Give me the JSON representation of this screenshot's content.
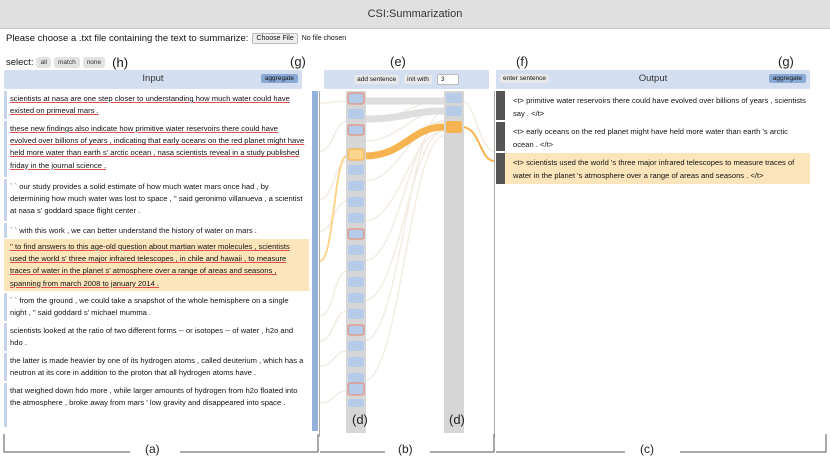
{
  "app": {
    "title": "CSI:Summarization"
  },
  "file": {
    "prompt": "Please choose a .txt file containing the text to summarize:",
    "button": "Choose File",
    "status": "No file chosen"
  },
  "select": {
    "label": "select:",
    "options": [
      "all",
      "match",
      "none"
    ]
  },
  "annotations": {
    "a": "(a)",
    "b": "(b)",
    "c": "(c)",
    "d1": "(d)",
    "d2": "(d)",
    "e": "(e)",
    "f": "(f)",
    "g1": "(g)",
    "g2": "(g)",
    "h": "(h)"
  },
  "input_header": {
    "title": "Input",
    "aggregate": "aggregate"
  },
  "middle_header": {
    "add_sentence": "add sentence",
    "init_with": "init with",
    "init_value": "3"
  },
  "output_header": {
    "enter_sentence": "enter sentence",
    "title": "Output",
    "aggregate": "aggregate"
  },
  "input_sentences": [
    "scientists at nasa are one step closer to understanding how much water could have existed on primeval mars .",
    "these new findings also indicate how primitive water reservoirs there could have evolved over billions of years , indicating that early oceans on the red planet might have held more water than earth s' arctic ocean , nasa scientists reveal in a study published friday in the journal science .",
    "` ` our study provides a solid estimate of how much water mars once had , by determining how much water was lost to space , '' said geronimo villanueva , a scientist at nasa s' goddard space flight center .",
    "` ` with this work , we can better understand the history of water on mars .",
    "'' to find answers to this age-old question about martian water molecules , scientists used the world s' three major infrared telescopes , in chile and hawaii , to measure traces of water in the planet s' atmosphere over a range of areas and seasons , spanning from march 2008 to january 2014 .",
    "` ` from the ground , we could take a snapshot of the whole hemisphere on a single night , '' said goddard s' michael mumma .",
    "scientists looked at the ratio of two different forms -- or isotopes -- of water , h2o and hdo .",
    "the latter is made heavier by one of its hydrogen atoms , called deuterium , which has a neutron at its core in addition to the proton that all hydrogen atoms have .",
    "that weighed down hdo more , while larger amounts of hydrogen from h2o floated into the atmosphere , broke away from mars ' low gravity and disappeared into space ."
  ],
  "output_sentences": [
    "<t> primitive water reservoirs there could have evolved over billions of years , scientists say . </t>",
    "<t> early oceans on the red planet might have held more water than earth 's arctic ocean . </t>",
    "<t> scientists used the world 's three major infrared telescopes to measure traces of water in the planet 's atmosphere over a range of areas and seasons . </t>"
  ],
  "colors": {
    "highlight": "#fde5bb",
    "link": "#f6b451",
    "accent": "#8aaad6",
    "underline": "#e24d4d"
  }
}
